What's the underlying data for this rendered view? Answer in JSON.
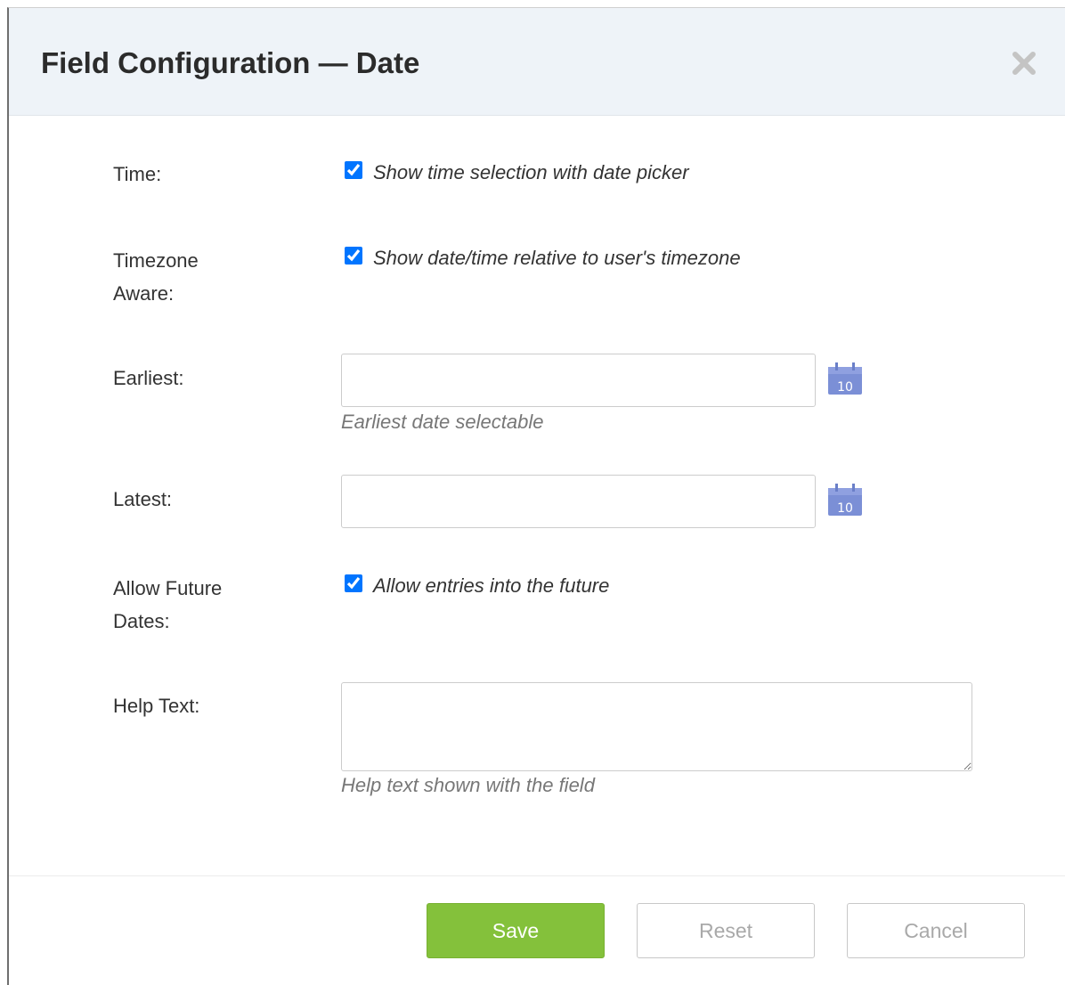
{
  "dialog": {
    "title": "Field Configuration — Date",
    "close_icon": "close-icon"
  },
  "form": {
    "time": {
      "label": "Time:",
      "checked": true,
      "option_text": "Show time selection with date picker"
    },
    "timezone": {
      "label_line1": "Timezone",
      "label_line2": "Aware:",
      "checked": true,
      "option_text": "Show date/time relative to user's timezone"
    },
    "earliest": {
      "label": "Earliest:",
      "value": "",
      "help": "Earliest date selectable",
      "icon": "calendar-icon",
      "icon_day": "10"
    },
    "latest": {
      "label": "Latest:",
      "value": "",
      "icon": "calendar-icon",
      "icon_day": "10"
    },
    "future": {
      "label_line1": "Allow Future",
      "label_line2": "Dates:",
      "checked": true,
      "option_text": "Allow entries into the future"
    },
    "help_text": {
      "label": "Help Text:",
      "value": "",
      "help": "Help text shown with the field"
    }
  },
  "buttons": {
    "save": "Save",
    "reset": "Reset",
    "cancel": "Cancel"
  },
  "colors": {
    "header_bg": "#eef3f8",
    "save_green": "#84c13b",
    "calendar_blue": "#7b8fd6"
  }
}
